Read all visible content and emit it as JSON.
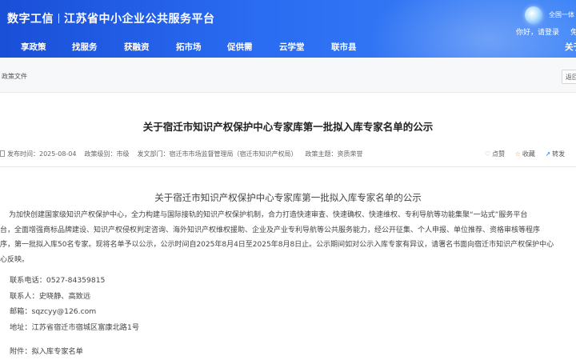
{
  "header": {
    "brand_left": "数字工信",
    "brand_right": "江苏省中小企业公共服务平台",
    "badge_text": "全国一体",
    "login_greeting": "你好，请登录",
    "login_extra": "免"
  },
  "nav": {
    "items": [
      "享政策",
      "找服务",
      "获融资",
      "拓市场",
      "促供需",
      "云学堂",
      "联市县"
    ],
    "right_item": "关于"
  },
  "breadcrumb": {
    "text": "政策文件",
    "back_label": "返回"
  },
  "article": {
    "title": "关于宿迁市知识产权保护中心专家库第一批拟入库专家名单的公示",
    "meta": {
      "publish_time": "发布时间：2025-08-04",
      "level": "政策级别：市级",
      "department": "发文部门：宿迁市市场监督管理局（宿迁市知识产权局）",
      "category": "政策主题：资质荣誉"
    },
    "actions": {
      "like": "点赞",
      "favorite": "收藏",
      "share": "转发"
    },
    "subtitle": "关于宿迁市知识产权保护中心专家库第一批拟入库专家名单的公示",
    "paragraph_lines": [
      "为加快创建国家级知识产权保护中心，全力构建与国际接轨的知识产权保护机制，合力打造快速审查、快速确权、快速维权、专利导航等功能集聚“一站式”服务平台",
      "台，全面增强商标品牌建设、知识产权侵权判定咨询、海外知识产权维权援助、企业及产业专利导航等公共服务能力，经公开征集、个人申报、单位推荐、资格审核等程序",
      "序，第一批拟入库50名专家。现将名单予以公示，公示时间自2025年8月4日至2025年8月8日止。公示期间如对公示入库专家有异议，请署名书面向宿迁市知识产权保护中心",
      "心反映。"
    ],
    "contact_phone": "联系电话：0527-84359815",
    "contact_people": "联系人：史晓静、高致远",
    "email": "邮箱：sqzcyy@126.com",
    "address": "地址：江苏省宿迁市宿城区富康北路1号",
    "attachment": "附件：拟入库专家名单"
  },
  "icons": {
    "like": "thumbs-up-icon",
    "favorite": "star-icon",
    "share": "share-icon",
    "publish": "document-icon",
    "badge": "globe-badge-icon"
  },
  "colors": {
    "header_blue": "#2a6cf2",
    "action_orange": "#f0a020"
  }
}
